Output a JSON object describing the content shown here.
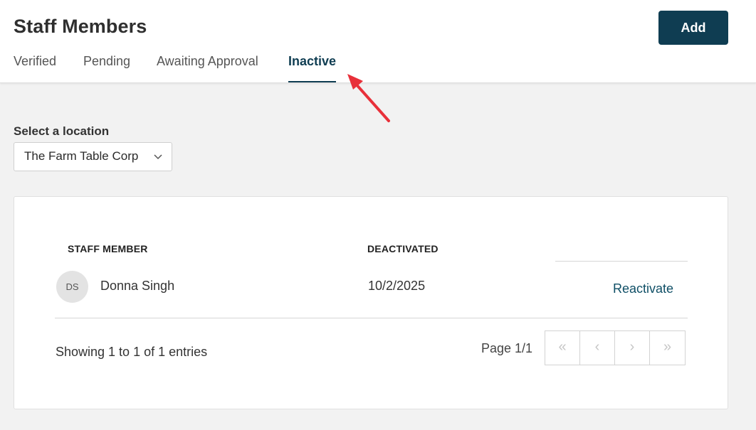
{
  "header": {
    "title": "Staff Members",
    "add_label": "Add"
  },
  "tabs": [
    {
      "label": "Verified",
      "active": false
    },
    {
      "label": "Pending",
      "active": false
    },
    {
      "label": "Awaiting Approval",
      "active": false
    },
    {
      "label": "Inactive",
      "active": true
    }
  ],
  "location": {
    "label": "Select a location",
    "selected": "The Farm Table Corp"
  },
  "table": {
    "columns": [
      "STAFF MEMBER",
      "DEACTIVATED"
    ],
    "rows": [
      {
        "initials": "DS",
        "name": "Donna Singh",
        "deactivated": "10/2/2025",
        "action": "Reactivate"
      }
    ]
  },
  "footer": {
    "entries_text": "Showing 1 to 1 of 1 entries",
    "page_text": "Page 1/1",
    "pager": {
      "first": "«",
      "prev": "‹",
      "next": "›",
      "last": "»"
    }
  },
  "colors": {
    "accent": "#0f3d52",
    "annotation_arrow": "#e8303a"
  },
  "icons": [
    "chevron-down-icon",
    "first-page-icon",
    "previous-page-icon",
    "next-page-icon",
    "last-page-icon",
    "annotation-arrow"
  ]
}
